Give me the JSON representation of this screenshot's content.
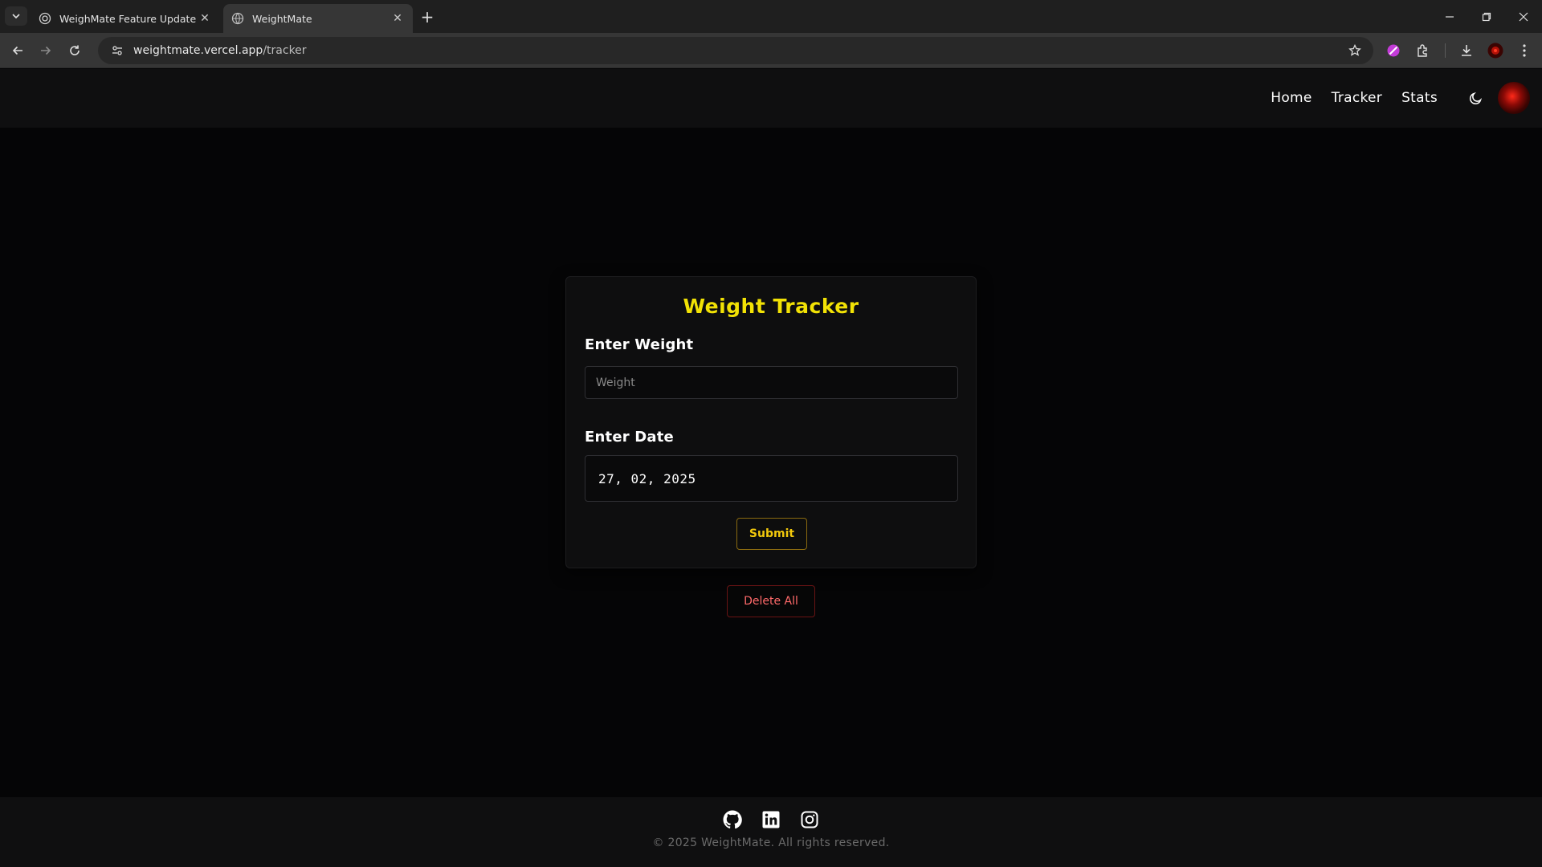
{
  "browser": {
    "tabs": [
      {
        "title": "WeighMate Feature Update",
        "active": false
      },
      {
        "title": "WeightMate",
        "active": true
      }
    ],
    "url_host": "weightmate.vercel.app",
    "url_path": "/tracker"
  },
  "nav": {
    "links": [
      "Home",
      "Tracker",
      "Stats"
    ],
    "icons": {
      "theme": "moon-icon",
      "avatar": "user-avatar"
    }
  },
  "tracker": {
    "title": "Weight Tracker",
    "weight_label": "Enter Weight",
    "weight_placeholder": "Weight",
    "weight_value": "",
    "date_label": "Enter Date",
    "date_value": "27, 02, 2025",
    "submit_label": "Submit",
    "delete_all_label": "Delete All"
  },
  "footer": {
    "social_icons": [
      "github-icon",
      "linkedin-icon",
      "instagram-icon"
    ],
    "copyright": "© 2025 WeightMate. All rights reserved."
  },
  "colors": {
    "accent_yellow": "#f2e205",
    "button_yellow": "#f2c80c",
    "danger_red": "#ff6a6a",
    "background": "#050506"
  }
}
